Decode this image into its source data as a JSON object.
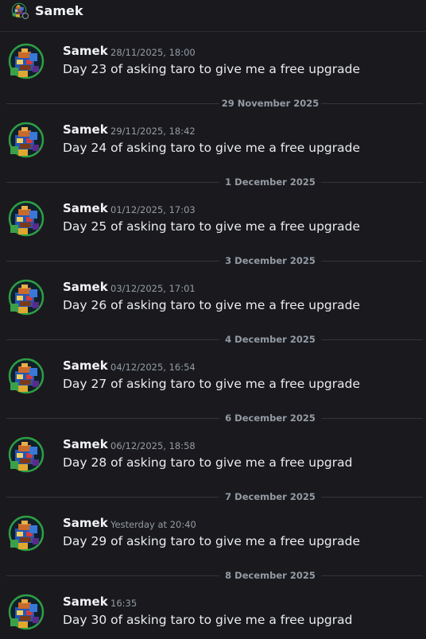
{
  "header": {
    "name": "Samek",
    "status": "offline"
  },
  "messages": [
    {
      "author": "Samek",
      "timestamp": "28/11/2025, 18:00",
      "text": "Day 23 of asking taro to give me a free upgrade"
    },
    {
      "author": "Samek",
      "timestamp": "29/11/2025, 18:42",
      "text": "Day 24 of asking taro to give me a free upgrade"
    },
    {
      "author": "Samek",
      "timestamp": "01/12/2025, 17:03",
      "text": "Day 25 of asking taro to give me a free upgrade"
    },
    {
      "author": "Samek",
      "timestamp": "03/12/2025, 17:01",
      "text": "Day 26 of asking taro to give me a free upgrade"
    },
    {
      "author": "Samek",
      "timestamp": "04/12/2025, 16:54",
      "text": "Day 27 of asking taro to give me a free upgrade"
    },
    {
      "author": "Samek",
      "timestamp": "06/12/2025, 18:58",
      "text": "Day 28 of asking taro to give me a free upgrad"
    },
    {
      "author": "Samek",
      "timestamp": "Yesterday at 20:40",
      "text": "Day 29 of asking taro to give me a free upgrade"
    },
    {
      "author": "Samek",
      "timestamp": "16:35",
      "text": "Day 30 of asking taro to give me a free upgrad"
    }
  ],
  "dividers": [
    "29 November 2025",
    "1 December 2025",
    "3 December 2025",
    "4 December 2025",
    "6 December 2025",
    "7 December 2025",
    "8 December 2025"
  ],
  "colors": {
    "background": "#1a1a1e",
    "author": "#f2f3f5",
    "timestamp": "#949ba4",
    "message_text": "#eaecef",
    "avatar_ring": "#2ea043"
  },
  "icons": {
    "avatar": "pixel-art-avatar-icon",
    "status": "offline-status-icon"
  }
}
